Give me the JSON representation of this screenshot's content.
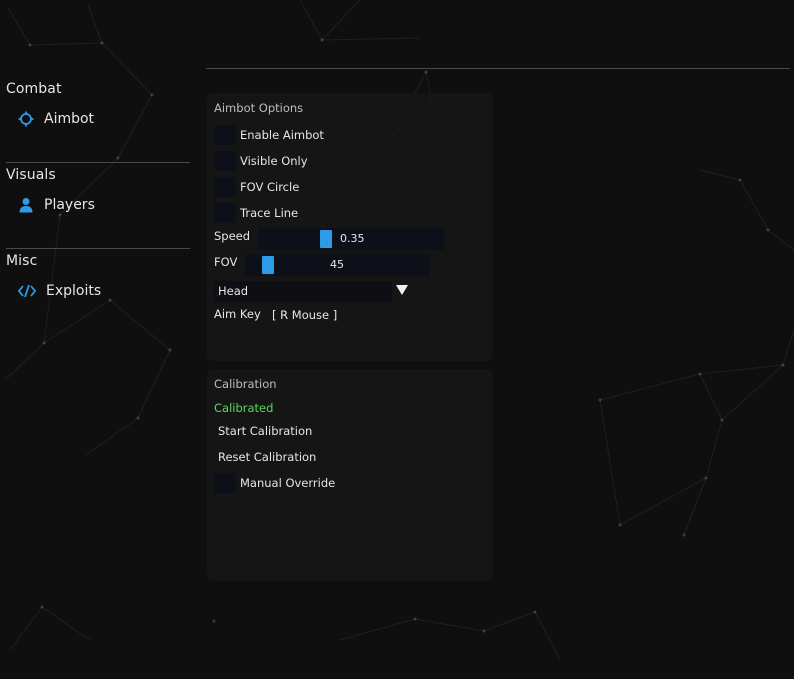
{
  "sidebar": {
    "categories": [
      {
        "label": "Combat",
        "item": {
          "label": "Aimbot",
          "icon": "crosshair-icon"
        }
      },
      {
        "label": "Visuals",
        "item": {
          "label": "Players",
          "icon": "user-icon"
        }
      },
      {
        "label": "Misc",
        "item": {
          "label": "Exploits",
          "icon": "code-icon"
        }
      }
    ],
    "accent": "#2d9be6"
  },
  "aimbot": {
    "title": "Aimbot Options",
    "checkboxes": [
      "Enable Aimbot",
      "Visible Only",
      "FOV Circle",
      "Trace Line"
    ],
    "speed": {
      "label": "Speed",
      "value": "0.35"
    },
    "fov": {
      "label": "FOV",
      "value": "45"
    },
    "target_bone": "Head",
    "aim_key": {
      "label": "Aim Key",
      "value": "[ R Mouse ]"
    }
  },
  "calibration": {
    "title": "Calibration",
    "status": "Calibrated",
    "status_color": "#5cd85c",
    "buttons": [
      "Start Calibration",
      "Reset Calibration"
    ],
    "override_label": "Manual Override"
  }
}
